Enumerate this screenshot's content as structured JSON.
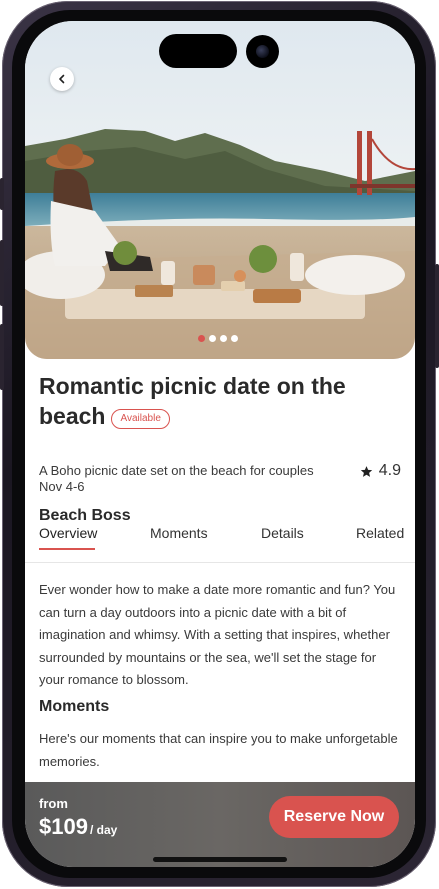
{
  "hero": {
    "carousel_dots": [
      true,
      false,
      false,
      false
    ]
  },
  "listing": {
    "title": "Romantic picnic date on the beach",
    "badge": "Available",
    "description": "A Boho picnic date set on the beach for couples",
    "rating_icon": "star-icon",
    "rating": "4.9",
    "dates": "Nov 4-6",
    "host": "Beach Boss"
  },
  "tabs": [
    {
      "label": "Overview",
      "active": true
    },
    {
      "label": "Moments",
      "active": false
    },
    {
      "label": "Details",
      "active": false
    },
    {
      "label": "Related",
      "active": false
    }
  ],
  "overview": {
    "text": "Ever wonder how to make a date more romantic and fun? You can turn a day outdoors into a picnic date with a bit of imagination and whimsy. With a setting that inspires, whether surrounded by mountains or the sea, we'll set the stage for your romance to blossom."
  },
  "moments": {
    "heading": "Moments",
    "text": "Here's our moments that can inspire you to make unforgetable memories."
  },
  "booking": {
    "from_label": "from",
    "price": "$109",
    "unit": "/ day",
    "cta": "Reserve Now"
  },
  "colors": {
    "accent": "#d9534f",
    "title_text": "#2a2a2a"
  }
}
